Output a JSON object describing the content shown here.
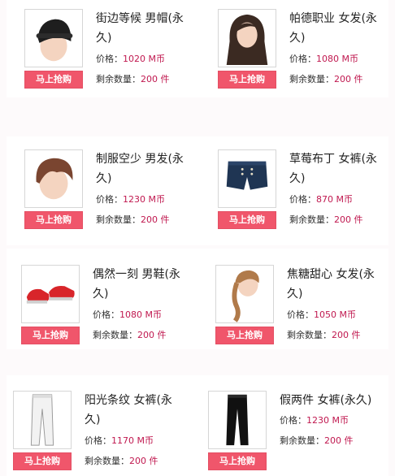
{
  "buy_label": "马上抢购",
  "price_label": "价格：",
  "stock_label": "剩余数量：",
  "currency": "M币",
  "stock_unit": "件",
  "products": [
    {
      "name": "街边等候 男帽(永久)",
      "price": "1020",
      "stock": "200",
      "icon": "male-cap-icon"
    },
    {
      "name": "帕德职业 女发(永久)",
      "price": "1080",
      "stock": "200",
      "icon": "female-long-hair-icon"
    },
    {
      "name": "制服空少 男发(永久)",
      "price": "1230",
      "stock": "200",
      "icon": "male-hair-icon"
    },
    {
      "name": "草莓布丁 女裤(永久)",
      "price": "870",
      "stock": "200",
      "icon": "denim-shorts-icon"
    },
    {
      "name": "偶然一刻 男鞋(永久)",
      "price": "1080",
      "stock": "200",
      "icon": "red-sneakers-icon"
    },
    {
      "name": "焦糖甜心 女发(永久)",
      "price": "1050",
      "stock": "200",
      "icon": "braided-hair-icon"
    },
    {
      "name": "阳光条纹 女裤(永久)",
      "price": "1170",
      "stock": "200",
      "icon": "white-pants-icon"
    },
    {
      "name": "假两件 女裤(永久)",
      "price": "1230",
      "stock": "200",
      "icon": "black-pants-icon"
    }
  ]
}
